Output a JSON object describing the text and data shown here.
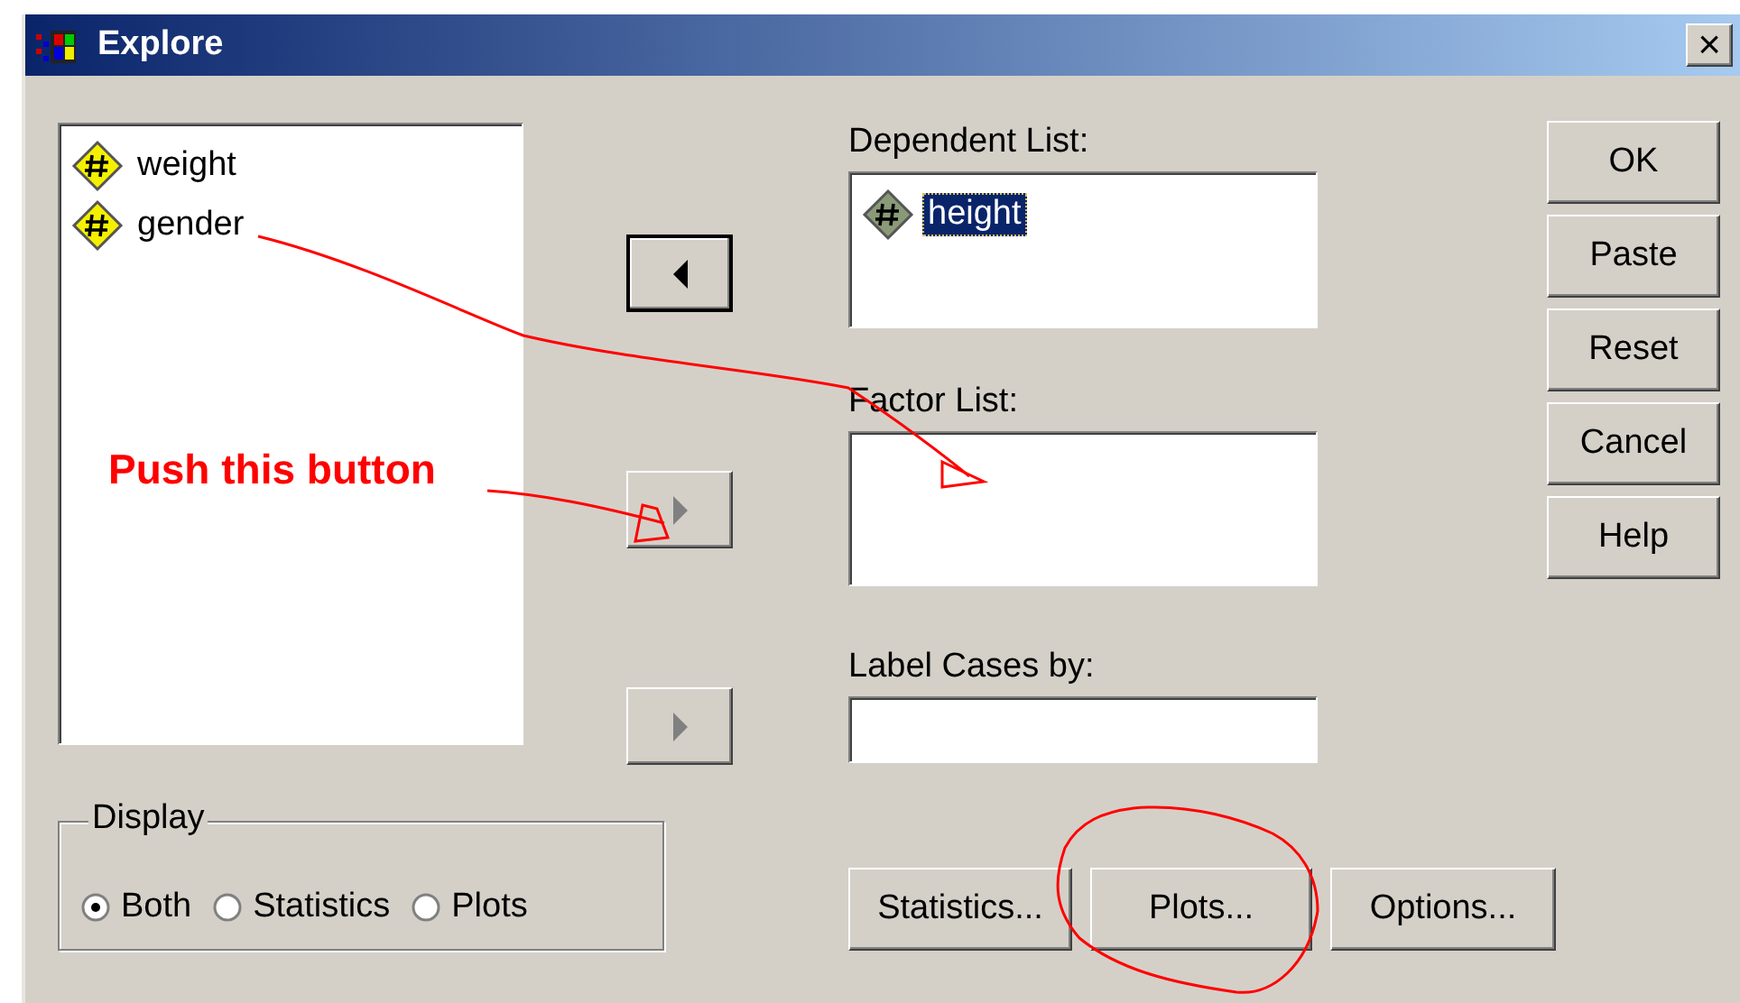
{
  "window": {
    "title": "Explore",
    "close_label": "×"
  },
  "source_list": {
    "items": [
      {
        "label": "weight",
        "selected": false
      },
      {
        "label": "gender",
        "selected": false
      }
    ]
  },
  "transfer_buttons": [
    {
      "kind": "left",
      "disabled": false,
      "default": true
    },
    {
      "kind": "right",
      "disabled": true,
      "default": false
    },
    {
      "kind": "right",
      "disabled": true,
      "default": false
    }
  ],
  "dependent_list": {
    "label": "Dependent List:",
    "items": [
      {
        "label": "height",
        "selected": true
      }
    ]
  },
  "factor_list": {
    "label": "Factor List:"
  },
  "label_cases": {
    "label": "Label Cases by:"
  },
  "action_buttons": [
    "OK",
    "Paste",
    "Reset",
    "Cancel",
    "Help"
  ],
  "display": {
    "title": "Display",
    "options": [
      {
        "label": "Both",
        "selected": true
      },
      {
        "label": "Statistics",
        "selected": false
      },
      {
        "label": "Plots",
        "selected": false
      }
    ]
  },
  "bottom_buttons": [
    "Statistics...",
    "Plots...",
    "Options..."
  ],
  "annotation": {
    "text": "Push this button"
  }
}
